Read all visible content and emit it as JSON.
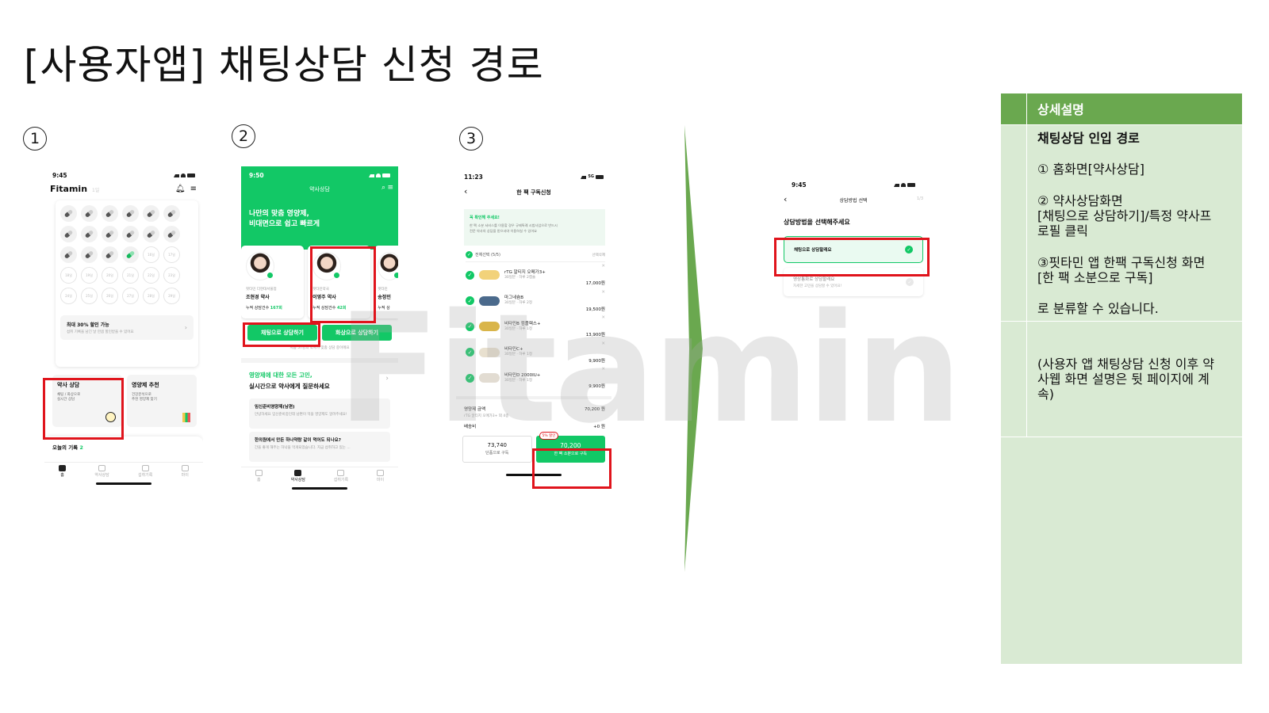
{
  "title": "[사용자앱] 채팅상담 신청 경로",
  "steps": [
    "1",
    "2",
    "3"
  ],
  "watermark": "Fitamin",
  "screen1": {
    "time": "9:45",
    "logo": "Fitamin",
    "logo_sub": "1일",
    "pill_labels": [
      "16일",
      "17일",
      "18일",
      "19일",
      "20일",
      "21일",
      "22일",
      "23일",
      "24일",
      "25일",
      "26일",
      "27일",
      "28일",
      "29일",
      "30일"
    ],
    "discount_title": "최대 30% 할인 가능",
    "discount_desc": "섭취 기록을 남긴 날 만큼 할인받을 수 있어요",
    "card_consult_title": "약사 상담",
    "card_consult_desc1": "채팅 / 화상으로",
    "card_consult_desc2": "실시간 상담",
    "card_recommend_title": "영양제 추천",
    "card_recommend_desc1": "건강분석으로",
    "card_recommend_desc2": "추천 영양제 찾기",
    "today_label": "오늘의 기록",
    "today_count": "2",
    "tabs": [
      "홈",
      "약사상담",
      "섭취기록",
      "마이"
    ]
  },
  "screen2": {
    "time": "9:50",
    "header_title": "약사상담",
    "hero_line1": "나만의 맞춤 영양제,",
    "hero_line2": "비대면으로 쉽고 빠르게",
    "pharmacists": [
      {
        "affiliation": "핏타민 더현대서울점",
        "name": "조현경 약사",
        "count_label": "누적 상담건수",
        "count": "167회"
      },
      {
        "affiliation": "핏타민약국",
        "name": "이영주 약사",
        "count_label": "누적 상담건수",
        "count": "42회"
      },
      {
        "affiliation": "핏타민",
        "name": "송정민",
        "count_label": "누적 상",
        "count": ""
      }
    ],
    "btn_chat": "채팅으로 상담하기",
    "btn_video": "화상으로 상담하기",
    "notice": "지금 57명의 약사가 맞춤 상담 중이에요",
    "section_title1": "영양제에 대한 모든 고민,",
    "section_title2": "실시간으로 약사에게 질문하세요",
    "qna": [
      {
        "q": "임신준비영양제(남편)",
        "a": "안녕하세요 임신준비중인데 남편이 먹을 영양제도 알려주세요!"
      },
      {
        "q": "한의원에서 만든 하나약랑 같이 먹어도 되나요?",
        "a": "간을 좋게 해주는 하낙을 먹게되었습니다. 지금 섭취하고 있는 ..."
      }
    ],
    "tabs": [
      "홈",
      "약사상담",
      "섭취기록",
      "마이"
    ]
  },
  "screen3": {
    "time": "11:23",
    "network": "5G",
    "header_title": "한 팩 구독신청",
    "notice_title": "꼭 확인해 주세요!",
    "notice_desc1": "한 팩 소분 서비스를 이용할 경우 규제특례 시범사업으로 반드시",
    "notice_desc2": "전문 약사의 상담을 받으셔야 이용하실 수 있어요",
    "select_all": "전체선택 (5/5)",
    "delete_selected": "선택삭제",
    "products": [
      {
        "name": "rTG 알티지 오메가3+",
        "sub": "30일분 · 하루 2캡슐",
        "price": "17,000원",
        "color": "#f2d27a"
      },
      {
        "name": "마그네슘B",
        "sub": "30일분 · 하루 2정",
        "price": "19,500원",
        "color": "#4b6a8c"
      },
      {
        "name": "비타민B 컴플렉스+",
        "sub": "30일분 · 하루 1정",
        "price": "13,900원",
        "color": "#d9b54a"
      },
      {
        "name": "비타민C+",
        "sub": "30일분 · 하루 1정",
        "price": "9,900원",
        "color": "#e8e0cf"
      },
      {
        "name": "비타민D 2000IU+",
        "sub": "30일분 · 하루 1정",
        "price": "9,900원",
        "color": "#e2dcd2"
      }
    ],
    "total_label": "영양제 금액",
    "total_value": "70,200 원",
    "total_sub": "rTG 알티지 오메가3+ 외 4종",
    "ship_label": "배송비",
    "ship_value": "+0 원",
    "btn_single_price": "73,740",
    "btn_single_label": "단품으로 구독",
    "discount_badge": "5% 할인",
    "btn_pack_price": "70,200",
    "btn_pack_label": "한 팩 소분으로 구독"
  },
  "screen4": {
    "time": "9:45",
    "header_title": "상담방법 선택",
    "page": "1/3",
    "question": "상담방법을 선택해주세요",
    "option_chat": "채팅으로 상담할래요",
    "option_video": "영상통화로 상담할래요",
    "option_video_desc": "자세한 고민을 상담할 수 있어요!"
  },
  "panel": {
    "header": "상세설명",
    "section_title": "채팅상담 인입 경로",
    "item1": "① 홈화면[약사상담]",
    "item2_line1": "② 약사상담화면",
    "item2_line2": "[채팅으로 상담하기]/특정 약사프",
    "item2_line3": "로필 클릭",
    "item3_line1": "③핏타민 앱 한팩 구독신청 화면",
    "item3_line2": "[한 팩 소분으로 구독]",
    "conclusion": "로 분류할 수 있습니다.",
    "note_line1": "(사용자 앱 채팅상담 신청 이후 약",
    "note_line2": "사웹 화면 설명은 뒷 페이지에 계",
    "note_line3": "속)"
  },
  "colors": {
    "brand_green": "#12C866",
    "highlight_red": "#E0141C",
    "panel_bg": "#D9EAD3",
    "panel_header": "#6AA84F",
    "arrow_green": "#6AA84F"
  }
}
